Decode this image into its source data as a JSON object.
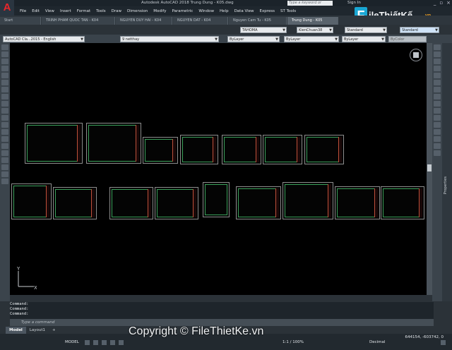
{
  "app": {
    "logo_letter": "A",
    "title": "Autodesk AutoCAD 2018    Trung Dung - K05.dwg",
    "search_placeholder": "Type a keyword or phrase",
    "sign_in": "Sign In",
    "window_controls": [
      "_",
      "▫",
      "×"
    ]
  },
  "menu": [
    "File",
    "Edit",
    "View",
    "Insert",
    "Format",
    "Tools",
    "Draw",
    "Dimension",
    "Modify",
    "Parametric",
    "Window",
    "Help",
    "Data View",
    "Express",
    "ST Tools"
  ],
  "brand": {
    "letter": "F",
    "name": "ileThiếtKế",
    "suffix": ".vn"
  },
  "doc_tabs": [
    {
      "label": "Start",
      "active": false
    },
    {
      "label": "TRINH PHAM QUOC TAN - K04",
      "active": false
    },
    {
      "label": "NGUYEN DUY HAI - K04",
      "active": false
    },
    {
      "label": "NGUYEN DAT - K04",
      "active": false
    },
    {
      "label": "Nguyen Cam Tu - K05",
      "active": false
    },
    {
      "label": "Trung Dung - K05",
      "active": true
    }
  ],
  "style_dropdowns": {
    "text_style": "TAHOMA",
    "dim_style": "KienChuan38",
    "table_style": "Standard",
    "mleader_style": "Standard"
  },
  "properties": {
    "workspace": "AutoCAD Cla...2015 - English",
    "layer": "9 netthay",
    "color": "ByLayer",
    "linetype": "ByLayer",
    "lineweight": "ByLayer",
    "plotstyle": "ByColor"
  },
  "ucs": {
    "x_label": "X",
    "y_label": "Y"
  },
  "command_history": [
    "Command:",
    "Command:",
    "Command:"
  ],
  "command_placeholder": "Type a command",
  "layout_tabs": [
    {
      "label": "Model",
      "active": true
    },
    {
      "label": "Layout1",
      "active": false
    },
    {
      "label": "+",
      "active": false
    }
  ],
  "status": {
    "coordinates": "644154, -603742, 0",
    "model": "MODEL",
    "scale": "1:1 / 100%",
    "units": "Decimal"
  },
  "right_panel_label": "Properties",
  "copyright": "Copyright © FileThietKe.vn"
}
